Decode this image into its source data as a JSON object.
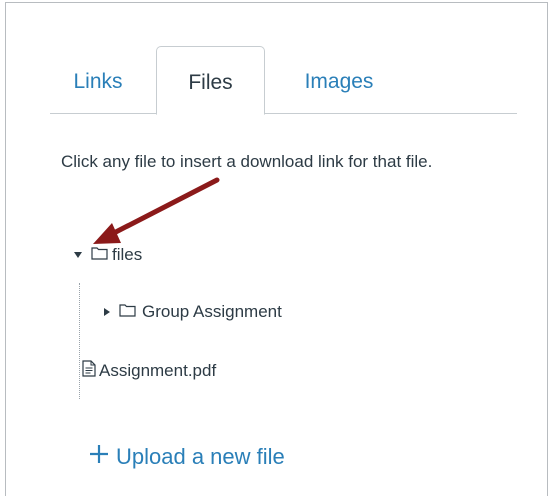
{
  "tabs": [
    {
      "label": "Links",
      "active": false
    },
    {
      "label": "Files",
      "active": true
    },
    {
      "label": "Images",
      "active": false
    }
  ],
  "instructions": "Click any file to insert a download link for that file.",
  "tree": {
    "root": {
      "label": "files",
      "icon": "folder-icon",
      "state": "expanded"
    },
    "children": [
      {
        "label": "Group Assignment",
        "icon": "folder-icon",
        "state": "collapsed"
      },
      {
        "label": "Assignment.pdf",
        "icon": "document-icon"
      }
    ]
  },
  "upload": {
    "label": "Upload a new file",
    "icon": "plus-icon"
  },
  "colors": {
    "link": "#2a7fb8",
    "text": "#2d3b45",
    "border": "#c7cdd1",
    "annotation_arrow": "#8b1a1a"
  }
}
